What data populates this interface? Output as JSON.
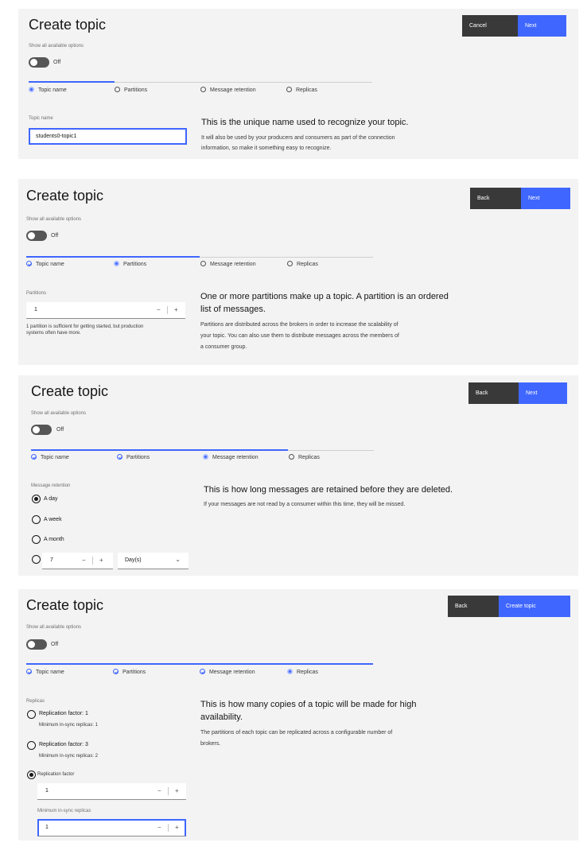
{
  "common": {
    "title": "Create topic",
    "show_options_label": "Show all available options",
    "toggle_state": "Off",
    "steps": [
      "Topic name",
      "Partitions",
      "Message retention",
      "Replicas"
    ]
  },
  "panel1": {
    "buttons": {
      "left": "Cancel",
      "right": "Next"
    },
    "current_step": "Topic name",
    "field_label": "Topic name",
    "field_value": "students0-topic1",
    "desc_head": "This is the unique name used to recognize your topic.",
    "desc_body_1": "It will also be used by your producers and consumers as part of the connection",
    "desc_body_2": "information, so make it something easy to recognize."
  },
  "panel2": {
    "buttons": {
      "left": "Back",
      "right": "Next"
    },
    "current_step": "Partitions",
    "field_label": "Partitions",
    "field_value": "1",
    "helper_1": "1 partition is sufficient for getting started, but production",
    "helper_2": "systems often have more.",
    "desc_head_1": "One or more partitions make up a topic. A partition is an ordered",
    "desc_head_2": "list of messages.",
    "desc_body_1": "Partitions are distributed across the brokers in order to increase the scalability of",
    "desc_body_2": "your topic. You can also use them to distribute messages across the members of",
    "desc_body_3": "a consumer group."
  },
  "panel3": {
    "buttons": {
      "left": "Back",
      "right": "Next"
    },
    "current_step": "Message retention",
    "field_label": "Message retention",
    "options": [
      "A day",
      "A week",
      "A month"
    ],
    "selected_option": "A day",
    "custom_value": "7",
    "custom_unit": "Day(s)",
    "desc_head": "This is how long messages are retained before they are deleted.",
    "desc_body": "If your messages are not read by a consumer within this time, they will be missed."
  },
  "panel4": {
    "buttons": {
      "left": "Back",
      "right": "Create topic"
    },
    "current_step": "Replicas",
    "field_label": "Replicas",
    "opt1_label": "Replication factor: 1",
    "opt1_sub": "Minimum in-sync replicas: 1",
    "opt2_label": "Replication factor: 3",
    "opt2_sub": "Minimum in-sync replicas: 2",
    "opt3_label": "Replication factor",
    "replication_value": "1",
    "min_insync_label": "Minimum in-sync replicas",
    "min_insync_value": "1",
    "desc_head_1": "This is how many copies of a topic will be made for high",
    "desc_head_2": "availability.",
    "desc_body_1": "The partitions of each topic can be replicated across a configurable number of",
    "desc_body_2": "brokers."
  },
  "colors": {
    "accent": "#3f66ff",
    "dark_button": "#393939",
    "panel_bg": "#f3f3f3"
  },
  "icons": {
    "current": "radio-filled-icon",
    "done": "checkmark-outline-icon",
    "pending": "circle-outline-icon",
    "chevron": "chevron-down-icon"
  }
}
